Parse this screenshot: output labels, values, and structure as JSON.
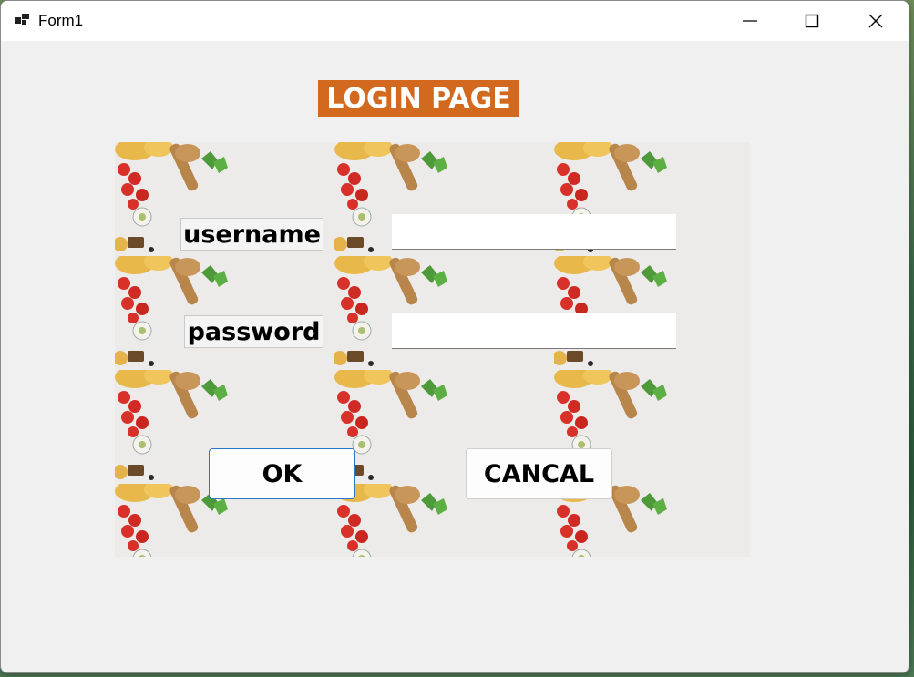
{
  "window": {
    "title": "Form1",
    "icons": {
      "app": "app-icon",
      "minimize": "minimize-icon",
      "maximize": "maximize-icon",
      "close": "close-icon"
    }
  },
  "form": {
    "heading": "LOGIN PAGE",
    "username_label": "username",
    "password_label": "password",
    "username_value": "",
    "password_value": "",
    "ok_label": "OK",
    "cancel_label": "CANCAL"
  },
  "colors": {
    "heading_bg": "#d2691e",
    "heading_text": "#ffffff",
    "form_bg": "#f0f0f0",
    "ok_focus_border": "#2a78c8"
  }
}
